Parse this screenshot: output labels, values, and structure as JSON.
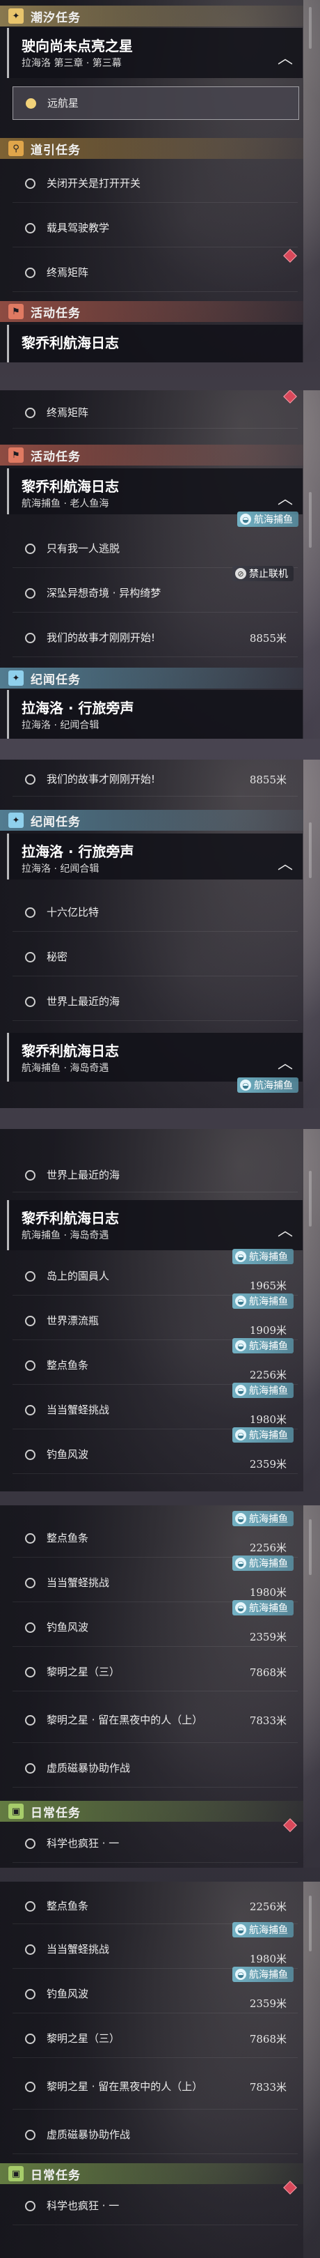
{
  "tags": {
    "fishing": "航海捕鱼",
    "no_coop": "禁止联机"
  },
  "frame1": {
    "cat_tide": "潮汐任务",
    "card1_title": "驶向尚未点亮之星",
    "card1_sub": "拉海洛 第三章 · 第三幕",
    "item_sel": "远航星",
    "cat_guide": "道引任务",
    "guide_items": [
      "关闭开关是打开开关",
      "载具驾驶教学",
      "终焉矩阵"
    ],
    "cat_event": "活动任务",
    "card2_title": "黎乔利航海日志"
  },
  "frame2": {
    "item0": "终焉矩阵",
    "cat_event": "活动任务",
    "card_title": "黎乔利航海日志",
    "card_sub": "航海捕鱼 · 老人鱼海",
    "items": [
      "只有我一人逃脱",
      "深坠异想奇境 · 异构绮梦",
      "我们的故事才刚刚开始!"
    ],
    "dist3": "8855米",
    "cat_chron": "纪闻任务",
    "card2_title": "拉海洛 · 行旅旁声",
    "card2_sub": "拉海洛 · 纪闻合辑"
  },
  "frame3": {
    "item0": "我们的故事才刚刚开始!",
    "dist0": "8855米",
    "cat_chron": "纪闻任务",
    "card_title": "拉海洛 · 行旅旁声",
    "card_sub": "拉海洛 · 纪闻合辑",
    "items": [
      "十六亿比特",
      "秘密",
      "世界上最近的海"
    ],
    "card2_title": "黎乔利航海日志",
    "card2_sub": "航海捕鱼 · 海岛奇遇"
  },
  "frame4": {
    "item0": "世界上最近的海",
    "card_title": "黎乔利航海日志",
    "card_sub": "航海捕鱼 · 海岛奇遇",
    "items": [
      {
        "name": "岛上的園員人",
        "dist": "1965米"
      },
      {
        "name": "世界漂流瓶",
        "dist": "1909米"
      },
      {
        "name": "整点鱼条",
        "dist": "2256米"
      },
      {
        "name": "当当蟹蛏挑战",
        "dist": "1980米"
      },
      {
        "name": "钓鱼风波",
        "dist": "2359米"
      }
    ]
  },
  "frame5": {
    "items": [
      {
        "name": "整点鱼条",
        "dist": "2256米"
      },
      {
        "name": "当当蟹蛏挑战",
        "dist": "1980米"
      },
      {
        "name": "钓鱼风波",
        "dist": "2359米"
      },
      {
        "name": "黎明之星（三）",
        "dist": "7868米"
      },
      {
        "name": "黎明之星 · 留在黑夜中的人（上）",
        "dist": "7833米"
      },
      {
        "name": "虚质磁暴协助作战",
        "dist": ""
      }
    ],
    "cat_daily": "日常任务",
    "daily_item": "科学也疯狂 · 一"
  },
  "frame6": {
    "items": [
      {
        "name": "整点鱼条",
        "dist": "2256米"
      },
      {
        "name": "当当蟹蛏挑战",
        "dist": "1980米"
      },
      {
        "name": "钓鱼风波",
        "dist": "2359米"
      },
      {
        "name": "黎明之星（三）",
        "dist": "7868米"
      },
      {
        "name": "黎明之星 · 留在黑夜中的人（上）",
        "dist": "7833米"
      },
      {
        "name": "虚质磁暴协助作战",
        "dist": ""
      }
    ],
    "cat_daily": "日常任务",
    "daily_item": "科学也疯狂 · 一"
  }
}
